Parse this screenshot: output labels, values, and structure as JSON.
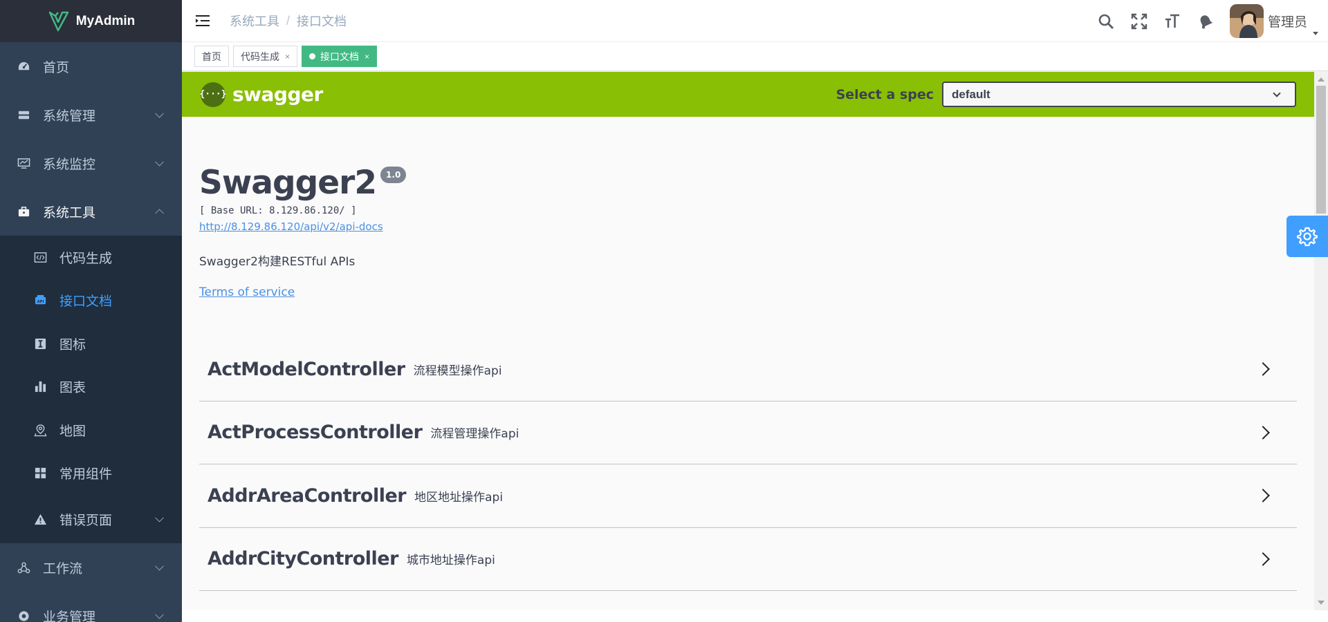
{
  "app": {
    "name": "MyAdmin"
  },
  "sidebar": {
    "items": [
      {
        "label": "首页",
        "icon": "dashboard-icon"
      },
      {
        "label": "系统管理",
        "icon": "system-icon"
      },
      {
        "label": "系统监控",
        "icon": "monitor-icon"
      },
      {
        "label": "系统工具",
        "icon": "toolbox-icon",
        "open": true
      },
      {
        "label": "工作流",
        "icon": "workflow-icon"
      },
      {
        "label": "业务管理",
        "icon": "business-icon"
      }
    ],
    "tools_sub": [
      {
        "label": "代码生成",
        "icon": "code-icon"
      },
      {
        "label": "接口文档",
        "icon": "api-doc-icon",
        "active": true
      },
      {
        "label": "图标",
        "icon": "icon-icon"
      },
      {
        "label": "图表",
        "icon": "chart-icon"
      },
      {
        "label": "地图",
        "icon": "map-icon"
      },
      {
        "label": "常用组件",
        "icon": "component-icon"
      },
      {
        "label": "错误页面",
        "icon": "error-icon"
      }
    ]
  },
  "navbar": {
    "breadcrumb": [
      "系统工具",
      "接口文档"
    ],
    "breadcrumb_sep": "/",
    "user_name": "管理员"
  },
  "tags": [
    {
      "label": "首页",
      "closable": false
    },
    {
      "label": "代码生成",
      "closable": true,
      "close": "×"
    },
    {
      "label": "接口文档",
      "closable": true,
      "active": true,
      "close": "×"
    }
  ],
  "swagger": {
    "logo_text": "swagger",
    "logo_glyph": "{···}",
    "spec_label": "Select a spec",
    "spec_value": "default",
    "title": "Swagger2",
    "version": "1.0",
    "base_url": "[ Base URL: 8.129.86.120/ ]",
    "docs_link": "http://8.129.86.120/api/v2/api-docs",
    "description": "Swagger2构建RESTful APIs",
    "terms": "Terms of service",
    "controllers": [
      {
        "name": "ActModelController",
        "desc": "流程模型操作api"
      },
      {
        "name": "ActProcessController",
        "desc": "流程管理操作api"
      },
      {
        "name": "AddrAreaController",
        "desc": "地区地址操作api"
      },
      {
        "name": "AddrCityController",
        "desc": "城市地址操作api"
      }
    ]
  },
  "colors": {
    "sidebar_bg": "#304156",
    "submenu_bg": "#1f2d3d",
    "active_menu": "#409eff",
    "tag_active": "#42b983",
    "swagger_green": "#89bf04"
  }
}
